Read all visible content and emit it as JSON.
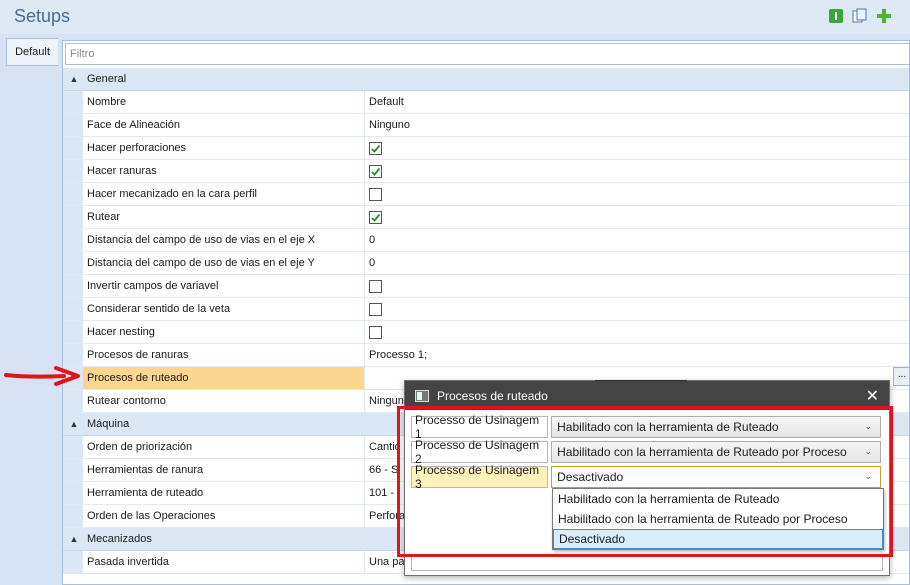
{
  "app": {
    "title": "Setups"
  },
  "toolbar": {
    "icons": [
      "info-icon",
      "copy-icon",
      "add-icon"
    ]
  },
  "tabs": [
    {
      "label": "Default"
    }
  ],
  "filter": {
    "placeholder": "Filtro"
  },
  "categories": {
    "general": "General",
    "maquina": "Máquina",
    "mecanizados": "Mecanizados"
  },
  "general_rows": [
    {
      "name": "Nombre",
      "value": "Default"
    },
    {
      "name": "Face de Alineación",
      "value": "Ninguno"
    },
    {
      "name": "Hacer perforaciones",
      "checked": true
    },
    {
      "name": "Hacer ranuras",
      "checked": true
    },
    {
      "name": "Hacer mecanizado en la cara perfil",
      "checked": false
    },
    {
      "name": "Rutear",
      "checked": true
    },
    {
      "name": "Distancia del campo de uso de vias en el eje X",
      "value": "0"
    },
    {
      "name": "Distancia del campo de uso de vias en el eje Y",
      "value": "0"
    },
    {
      "name": "Invertir campos de variavel",
      "checked": false
    },
    {
      "name": "Considerar sentido de la veta",
      "checked": false
    },
    {
      "name": "Hacer nesting",
      "checked": false
    },
    {
      "name": "Procesos de ranuras",
      "value": "Processo 1;"
    },
    {
      "name": "Procesos de ruteado",
      "value": ""
    },
    {
      "name": "Rutear contorno",
      "value": "Ningun"
    }
  ],
  "maquina_rows": [
    {
      "name": "Orden de priorización",
      "value": "Cantid"
    },
    {
      "name": "Herramientas de ranura",
      "value": "66 - S"
    },
    {
      "name": "Herramienta de ruteado",
      "value": "101 - "
    },
    {
      "name": "Orden de las Operaciones",
      "value": "Perfora"
    }
  ],
  "mecanizados_rows": [
    {
      "name": "Pasada invertida",
      "value": "Una pa"
    }
  ],
  "selected_row_button": "...",
  "dialog": {
    "title": "Procesos de ruteado",
    "close": "✕",
    "rows": [
      {
        "label": "Processo de Usinagem 1",
        "value": "Habilitado con la herramienta de Ruteado"
      },
      {
        "label": "Processo de Usinagem 2",
        "value": "Habilitado con la herramienta de Ruteado por Proceso"
      },
      {
        "label": "Processo de Usinagem 3",
        "value": "Desactivado"
      }
    ],
    "dropdown_options": [
      "Habilitado con la herramienta de Ruteado",
      "Habilitado con la herramienta de Ruteado por Proceso",
      "Desactivado"
    ]
  },
  "colors": {
    "highlight_row": "#fcd58f",
    "annotation_red": "#e0141a",
    "dialog_title_bg": "#444444"
  }
}
